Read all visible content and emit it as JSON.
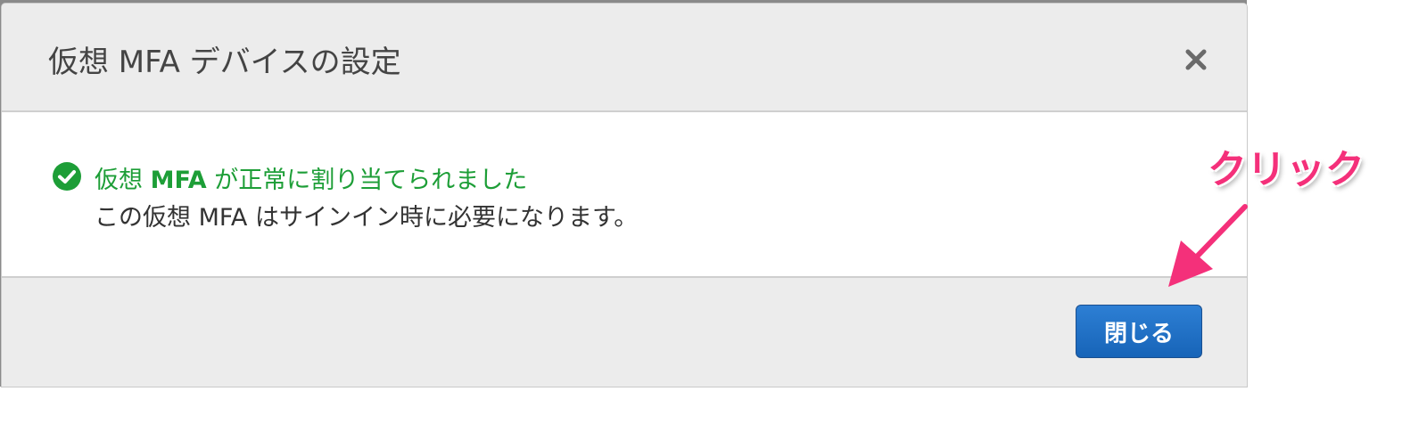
{
  "dialog": {
    "title": "仮想 MFA デバイスの設定",
    "close_icon": "close-icon"
  },
  "body": {
    "status_icon": "check-circle-icon",
    "status_color": "#1d9e37",
    "success_prefix": "仮想 ",
    "success_bold": "MFA",
    "success_suffix": " が正常に割り当てられました",
    "detail": "この仮想 MFA はサインイン時に必要になります。"
  },
  "footer": {
    "close_label": "閉じる",
    "button_color": "#1f6fc5"
  },
  "annotation": {
    "label": "クリック",
    "color": "#f4307a",
    "arrow_icon": "arrow-icon"
  }
}
